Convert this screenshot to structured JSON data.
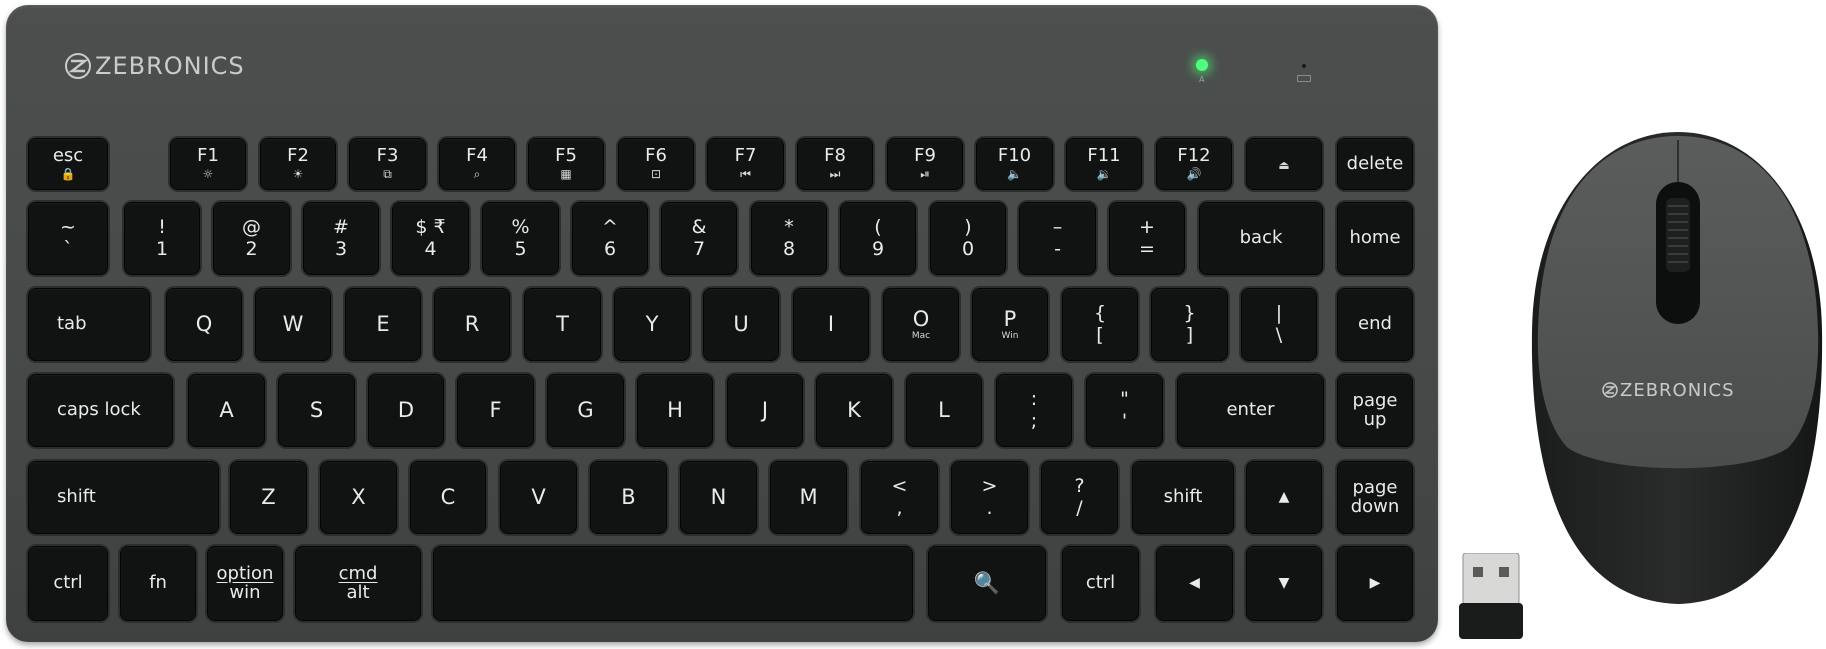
{
  "brand": "ZEBRONICS",
  "mouse_brand": "ZEBRONICS",
  "indicator": "A",
  "rows": [
    [
      {
        "id": "esc",
        "label": "esc",
        "icon": "🔒"
      },
      {
        "id": "f1",
        "label": "F1",
        "icon": "☼"
      },
      {
        "id": "f2",
        "label": "F2",
        "icon": "☀"
      },
      {
        "id": "f3",
        "label": "F3",
        "icon": "⧉"
      },
      {
        "id": "f4",
        "label": "F4",
        "icon": "⌕"
      },
      {
        "id": "f5",
        "label": "F5",
        "icon": "▦"
      },
      {
        "id": "f6",
        "label": "F6",
        "icon": "⊡"
      },
      {
        "id": "f7",
        "label": "F7",
        "icon": "⏮"
      },
      {
        "id": "f8",
        "label": "F8",
        "icon": "⏭"
      },
      {
        "id": "f9",
        "label": "F9",
        "icon": "⏯"
      },
      {
        "id": "f10",
        "label": "F10",
        "icon": "🔈"
      },
      {
        "id": "f11",
        "label": "F11",
        "icon": "🔉"
      },
      {
        "id": "f12",
        "label": "F12",
        "icon": "🔊"
      },
      {
        "id": "lock",
        "label": "",
        "icon": "⏏"
      },
      {
        "id": "delete",
        "label": "delete",
        "icon": ""
      }
    ],
    [
      {
        "id": "tilde",
        "top": "~",
        "bottom": "`"
      },
      {
        "id": "1",
        "top": "!",
        "bottom": "1"
      },
      {
        "id": "2",
        "top": "@",
        "bottom": "2"
      },
      {
        "id": "3",
        "top": "#",
        "bottom": "3"
      },
      {
        "id": "4",
        "top": "$ ₹",
        "bottom": "4"
      },
      {
        "id": "5",
        "top": "%",
        "bottom": "5"
      },
      {
        "id": "6",
        "top": "^",
        "bottom": "6"
      },
      {
        "id": "7",
        "top": "&",
        "bottom": "7"
      },
      {
        "id": "8",
        "top": "*",
        "bottom": "8"
      },
      {
        "id": "9",
        "top": "(",
        "bottom": "9"
      },
      {
        "id": "0",
        "top": ")",
        "bottom": "0"
      },
      {
        "id": "minus",
        "top": "–",
        "bottom": "-"
      },
      {
        "id": "equals",
        "top": "+",
        "bottom": "="
      },
      {
        "id": "back",
        "label": "back"
      },
      {
        "id": "home",
        "label": "home"
      }
    ],
    [
      {
        "id": "tab",
        "label": "tab"
      },
      {
        "id": "q",
        "label": "Q"
      },
      {
        "id": "w",
        "label": "W"
      },
      {
        "id": "e",
        "label": "E"
      },
      {
        "id": "r",
        "label": "R"
      },
      {
        "id": "t",
        "label": "T"
      },
      {
        "id": "y",
        "label": "Y"
      },
      {
        "id": "u",
        "label": "U"
      },
      {
        "id": "i",
        "label": "I"
      },
      {
        "id": "o",
        "label": "O",
        "sub": "Mac"
      },
      {
        "id": "p",
        "label": "P",
        "sub": "Win"
      },
      {
        "id": "lbrace",
        "top": "{",
        "bottom": "["
      },
      {
        "id": "rbrace",
        "top": "}",
        "bottom": "]"
      },
      {
        "id": "pipe",
        "top": "|",
        "bottom": "\\"
      },
      {
        "id": "end",
        "label": "end"
      }
    ],
    [
      {
        "id": "capslock",
        "label": "caps lock"
      },
      {
        "id": "a",
        "label": "A"
      },
      {
        "id": "s",
        "label": "S"
      },
      {
        "id": "d",
        "label": "D"
      },
      {
        "id": "f",
        "label": "F"
      },
      {
        "id": "g",
        "label": "G"
      },
      {
        "id": "h",
        "label": "H"
      },
      {
        "id": "j",
        "label": "J"
      },
      {
        "id": "k",
        "label": "K"
      },
      {
        "id": "l",
        "label": "L"
      },
      {
        "id": "semicolon",
        "top": ":",
        "bottom": ";"
      },
      {
        "id": "quote",
        "top": "\"",
        "bottom": "'"
      },
      {
        "id": "enter",
        "label": "enter"
      },
      {
        "id": "pageup",
        "top": "page",
        "bottom": "up"
      }
    ],
    [
      {
        "id": "lshift",
        "label": "shift"
      },
      {
        "id": "z",
        "label": "Z"
      },
      {
        "id": "x",
        "label": "X"
      },
      {
        "id": "c",
        "label": "C"
      },
      {
        "id": "v",
        "label": "V"
      },
      {
        "id": "b",
        "label": "B"
      },
      {
        "id": "n",
        "label": "N"
      },
      {
        "id": "m",
        "label": "M"
      },
      {
        "id": "comma",
        "top": "<",
        "bottom": ","
      },
      {
        "id": "period",
        "top": ">",
        "bottom": "."
      },
      {
        "id": "slash",
        "top": "?",
        "bottom": "/"
      },
      {
        "id": "rshift",
        "label": "shift"
      },
      {
        "id": "up",
        "label": "▲"
      },
      {
        "id": "pagedown",
        "top": "page",
        "bottom": "down"
      }
    ],
    [
      {
        "id": "lctrl",
        "label": "ctrl"
      },
      {
        "id": "fn",
        "label": "fn"
      },
      {
        "id": "option",
        "top": "option",
        "bottom": "win"
      },
      {
        "id": "cmd",
        "top": "cmd",
        "bottom": "alt"
      },
      {
        "id": "space",
        "label": ""
      },
      {
        "id": "search",
        "label": "🔍"
      },
      {
        "id": "rctrl",
        "label": "ctrl"
      },
      {
        "id": "left",
        "label": "◀"
      },
      {
        "id": "down",
        "label": "▼"
      },
      {
        "id": "right",
        "label": "▶"
      }
    ]
  ]
}
